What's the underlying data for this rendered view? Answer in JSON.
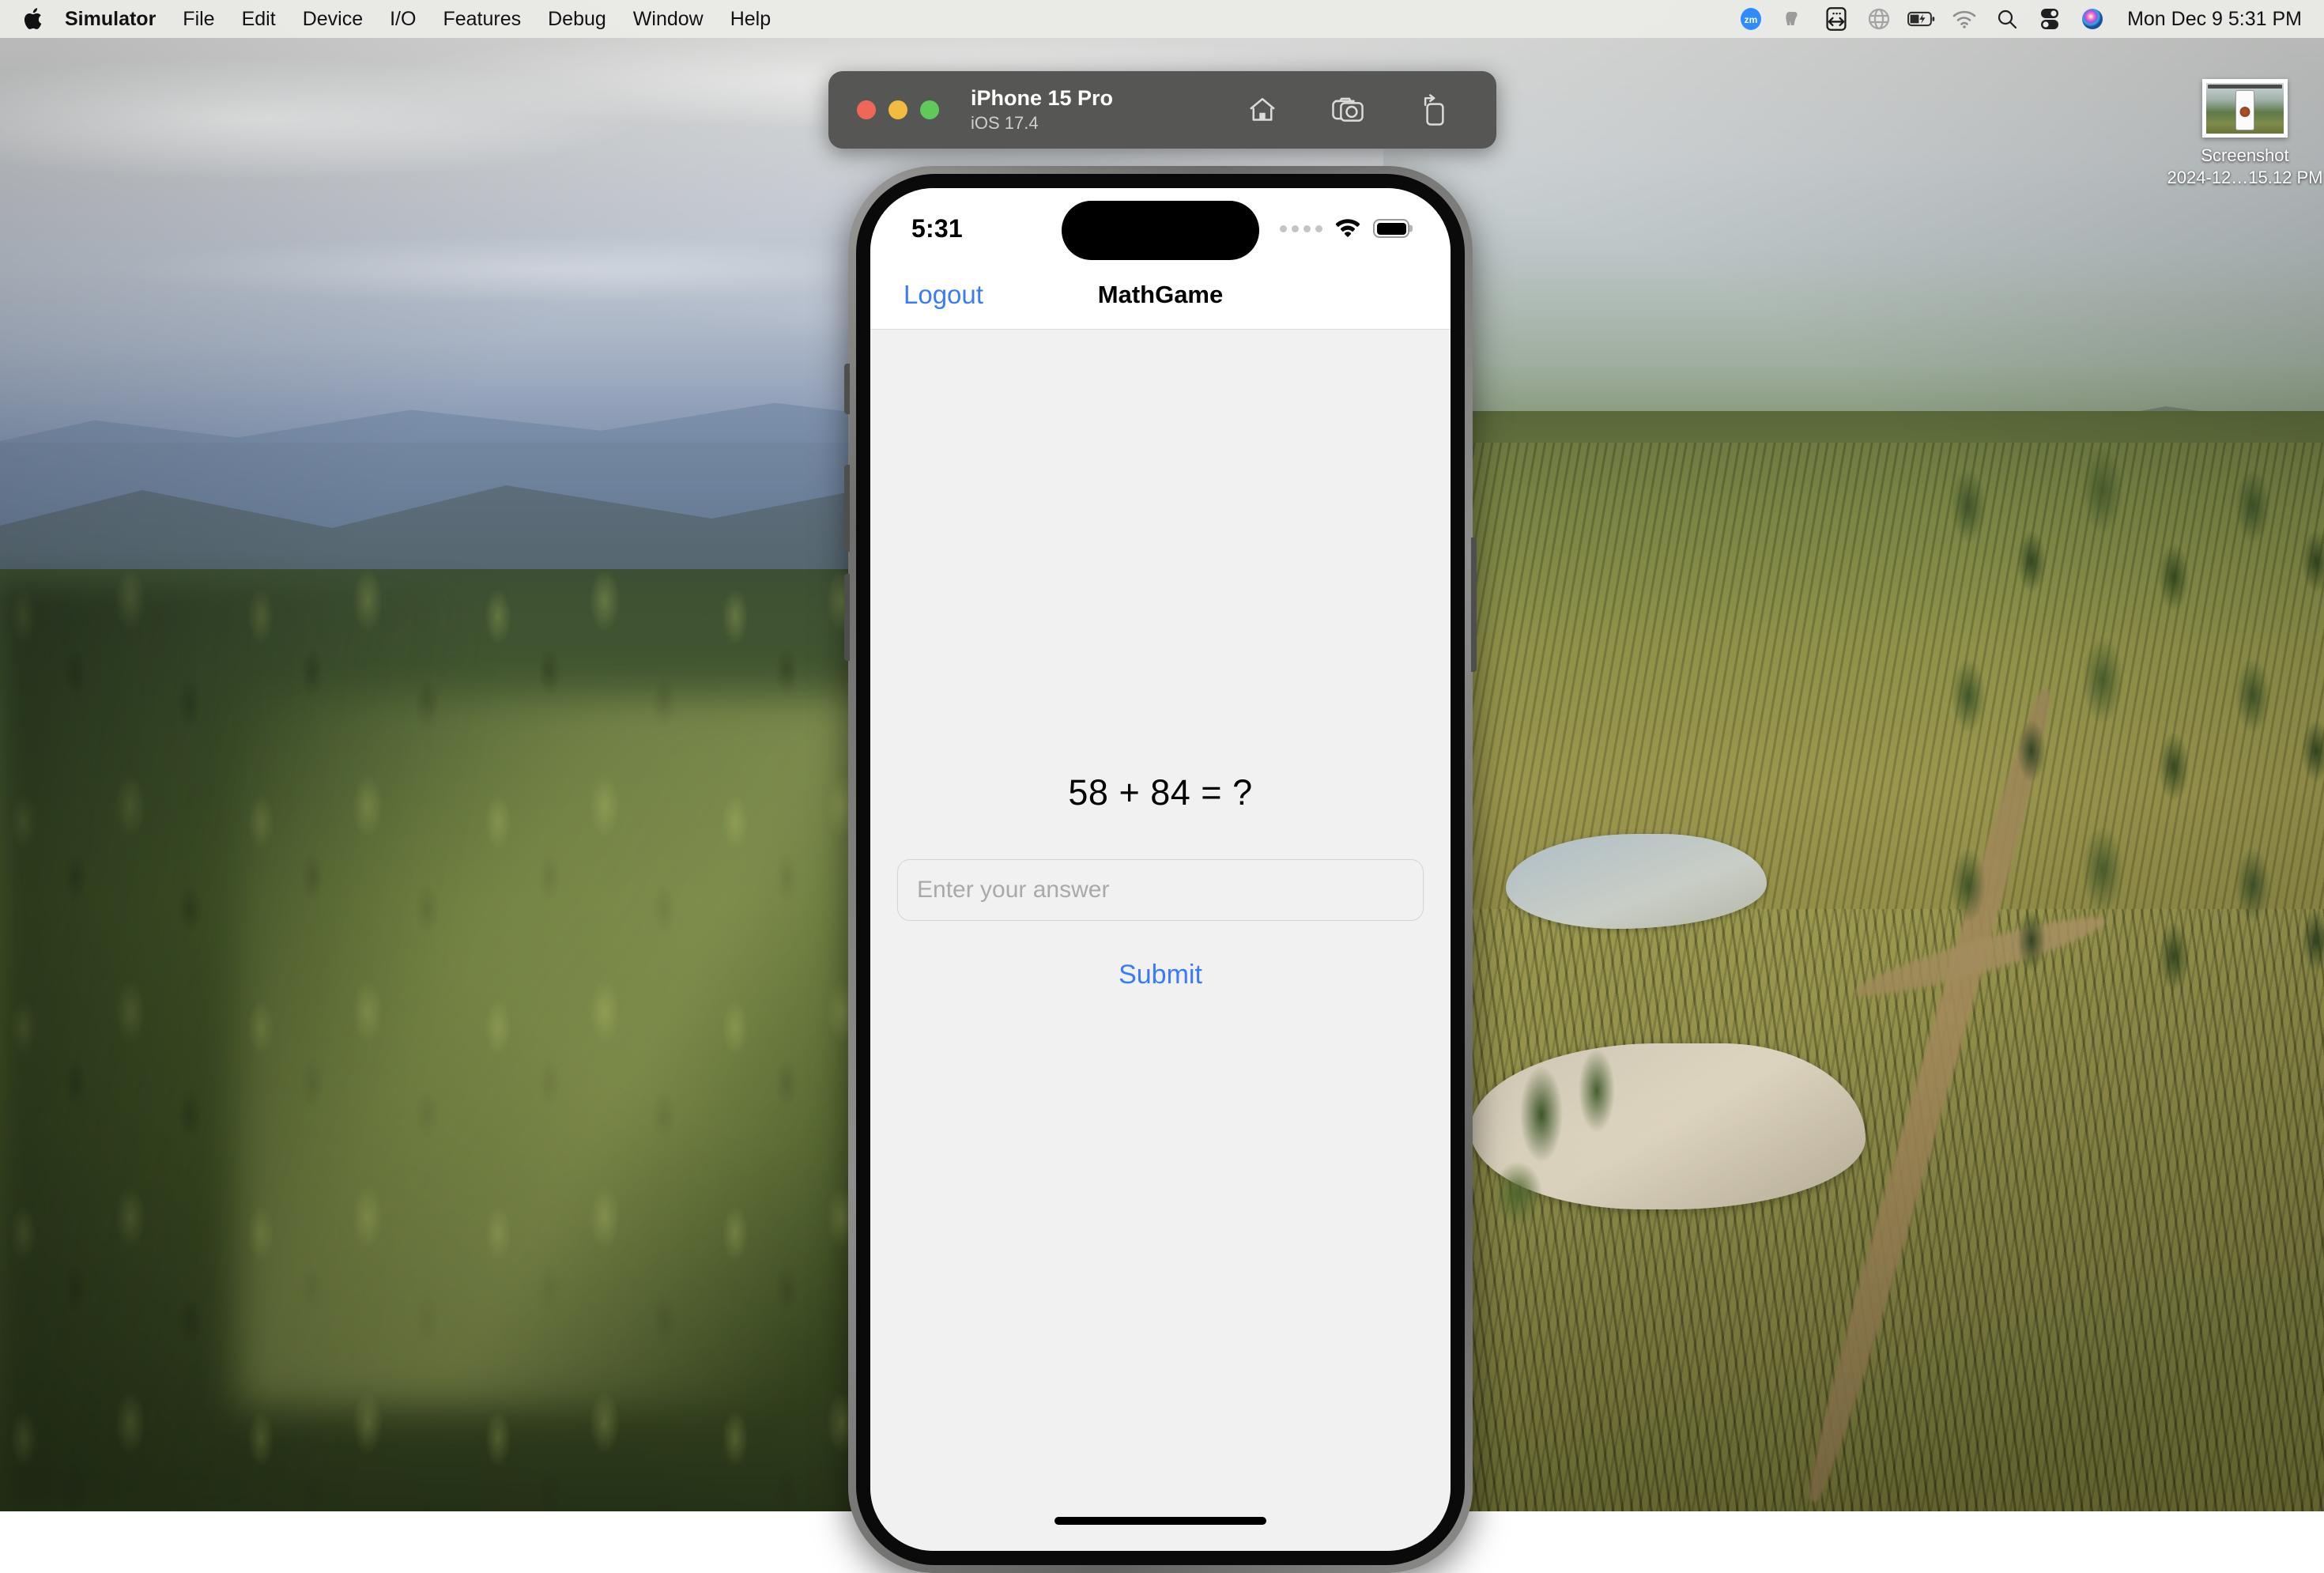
{
  "menubar": {
    "apple_icon": "apple-logo-icon",
    "app_name": "Simulator",
    "menus": [
      "File",
      "Edit",
      "Device",
      "I/O",
      "Features",
      "Debug",
      "Window",
      "Help"
    ],
    "status_icons": [
      "zoom-icon",
      "evernote-elephant-icon",
      "input-source-icon",
      "globe-icon",
      "battery-charging-icon",
      "wifi-icon",
      "spotlight-search-icon",
      "control-center-icon",
      "siri-icon"
    ],
    "clock": "Mon Dec 9  5:31 PM"
  },
  "desktop_icon": {
    "name_line1": "Screenshot",
    "name_line2": "2024-12…15.12 PM"
  },
  "simulator_window": {
    "traffic_lights": [
      "close-button",
      "minimize-button",
      "zoom-button"
    ],
    "device_name": "iPhone 15 Pro",
    "os_version": "iOS 17.4",
    "actions": [
      "home-icon",
      "screenshot-camera-icon",
      "rotate-device-icon"
    ]
  },
  "phone": {
    "status_bar": {
      "time": "5:31",
      "icons": [
        "cellular-dots-icon",
        "wifi-icon",
        "battery-icon"
      ]
    },
    "nav_bar": {
      "left_button": "Logout",
      "title": "MathGame"
    },
    "app": {
      "question": "58 + 84 = ?",
      "answer_value": "",
      "answer_placeholder": "Enter your answer",
      "submit_label": "Submit"
    },
    "side_buttons": [
      "action-button",
      "volume-up-button",
      "volume-down-button",
      "power-button"
    ],
    "home_indicator": "home-indicator"
  },
  "colors": {
    "ios_blue": "#3b7bfb",
    "content_bg": "#f1f1f1",
    "titlebar_bg": "#565654"
  }
}
